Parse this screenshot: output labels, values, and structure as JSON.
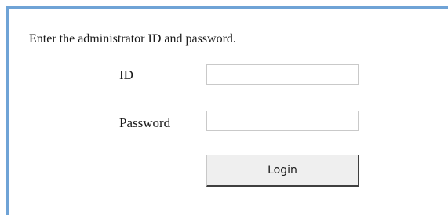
{
  "login": {
    "instruction": "Enter the administrator ID and password.",
    "id_label": "ID",
    "id_value": "",
    "password_label": "Password",
    "password_value": "",
    "button_label": "Login"
  },
  "colors": {
    "frame_border": "#6fa3d6",
    "button_face": "#efefef"
  }
}
